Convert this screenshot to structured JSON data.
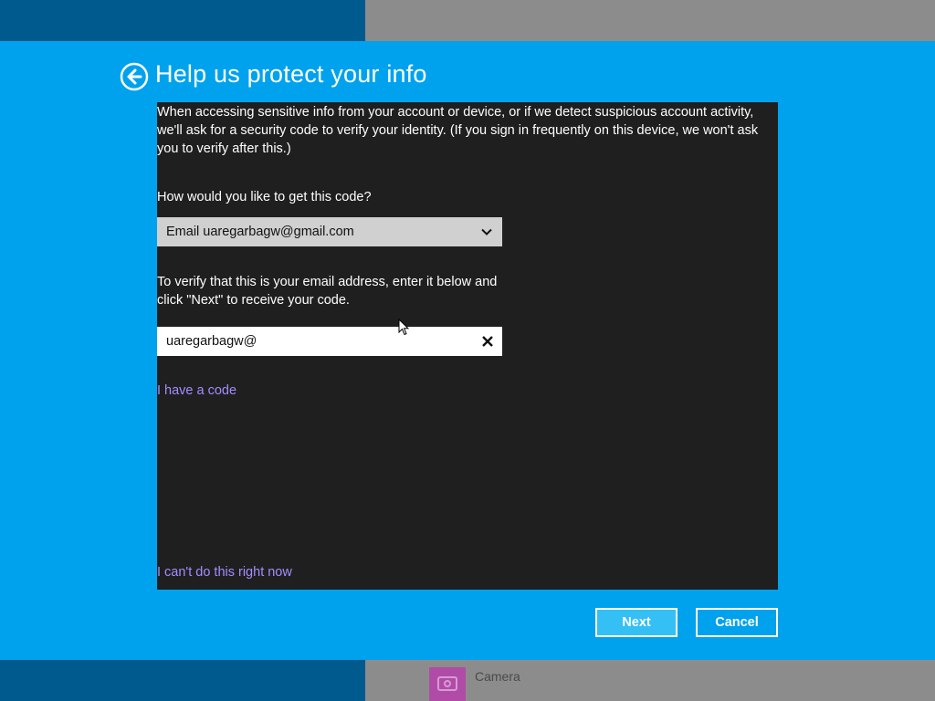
{
  "header": {
    "title": "Help us protect your info",
    "back_icon": "back-arrow-icon"
  },
  "main": {
    "description": "When accessing sensitive info from your account or device, or if we detect suspicious account activity, we'll ask for a security code to verify your identity. (If you sign in frequently on this device, we won't ask you to verify after this.)",
    "question": "How would you like to get this code?",
    "method_select": {
      "value": "Email uaregarbagw@gmail.com",
      "icon": "chevron-down-icon"
    },
    "instruction": "To verify that this is your email address, enter it below and click \"Next\" to receive your code.",
    "email_input": {
      "value": "uaregarbagw@",
      "clear_icon": "close-icon"
    },
    "have_code_link": "I have a code",
    "cant_do_link": "I can't do this right now"
  },
  "buttons": {
    "next": "Next",
    "cancel": "Cancel"
  },
  "background": {
    "camera_label": "Camera"
  },
  "colors": {
    "dialog_bg": "#00a2ed",
    "panel_bg": "#1f1f1f",
    "link": "#a58bff",
    "next_button_bg": "#34c0f5"
  }
}
